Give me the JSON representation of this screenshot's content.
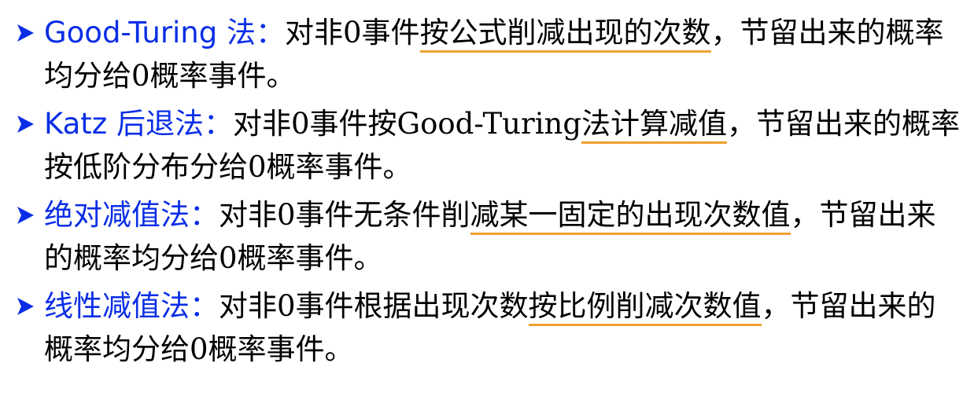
{
  "colors": {
    "term": "#0a2ee6",
    "text": "#000000",
    "underline": "#f0a030",
    "bullet": "#0a2ee6"
  },
  "bullet_icon": "arrowhead-bullet-icon",
  "items": [
    {
      "term": "Good-Turing 法",
      "colon": "：",
      "pre": "对非0事件",
      "highlight": "按公式削减出现的次数",
      "post": "，节留出来的概率均分给0概率事件。"
    },
    {
      "term": "Katz 后退法",
      "colon": "：",
      "pre": "对非0事件按Good-Turing",
      "highlight": "法计算减值",
      "post": "，节留出来的概率按低阶分布分给0概率事件。"
    },
    {
      "term": "绝对减值法",
      "colon": "：",
      "pre": "对非0事件无条件削",
      "highlight": "减某一固定的出现次数值",
      "post": "，节留出来的概率均分给0概率事件。"
    },
    {
      "term": "线性减值法",
      "colon": "：",
      "pre": "对非0事件根据出现次数",
      "highlight": "按比例削减次数值",
      "post": "，节留出来的概率均分给0概率事件。"
    }
  ]
}
